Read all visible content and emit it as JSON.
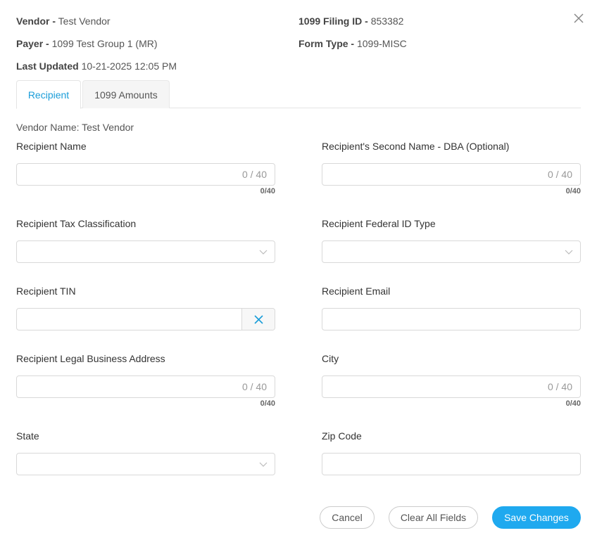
{
  "header": {
    "vendor_label": "Vendor -",
    "vendor_value": "Test Vendor",
    "payer_label": "Payer -",
    "payer_value": "1099 Test Group 1 (MR)",
    "updated_label": "Last Updated",
    "updated_value": "10-21-2025 12:05 PM",
    "filing_label": "1099 Filing ID -",
    "filing_value": "853382",
    "form_label": "Form Type -",
    "form_value": "1099-MISC"
  },
  "icons": {
    "close": "close-icon",
    "chevron": "chevron-down-icon",
    "clear": "clear-x-icon"
  },
  "tabs": [
    {
      "label": "Recipient",
      "active": true
    },
    {
      "label": "1099 Amounts",
      "active": false
    }
  ],
  "form": {
    "vendor_name": "Vendor Name: Test Vendor",
    "recipient_name": {
      "label": "Recipient Name",
      "value": "",
      "counter": "0 / 40",
      "sub_counter": "0/40"
    },
    "second_name": {
      "label": "Recipient's Second Name - DBA (Optional)",
      "value": "",
      "counter": "0 / 40",
      "sub_counter": "0/40"
    },
    "tax_classification": {
      "label": "Recipient Tax Classification",
      "value": ""
    },
    "federal_id_type": {
      "label": "Recipient Federal ID Type",
      "value": ""
    },
    "tin": {
      "label": "Recipient TIN",
      "value": ""
    },
    "email": {
      "label": "Recipient Email",
      "value": ""
    },
    "address": {
      "label": "Recipient Legal Business Address",
      "value": "",
      "counter": "0 / 40",
      "sub_counter": "0/40"
    },
    "city": {
      "label": "City",
      "value": "",
      "counter": "0 / 40",
      "sub_counter": "0/40"
    },
    "state": {
      "label": "State",
      "value": ""
    },
    "zip": {
      "label": "Zip Code",
      "value": ""
    }
  },
  "buttons": {
    "cancel": "Cancel",
    "clear_all": "Clear All Fields",
    "save": "Save Changes"
  },
  "colors": {
    "accent": "#1fa9ef",
    "tab_active": "#1a9dd9"
  }
}
